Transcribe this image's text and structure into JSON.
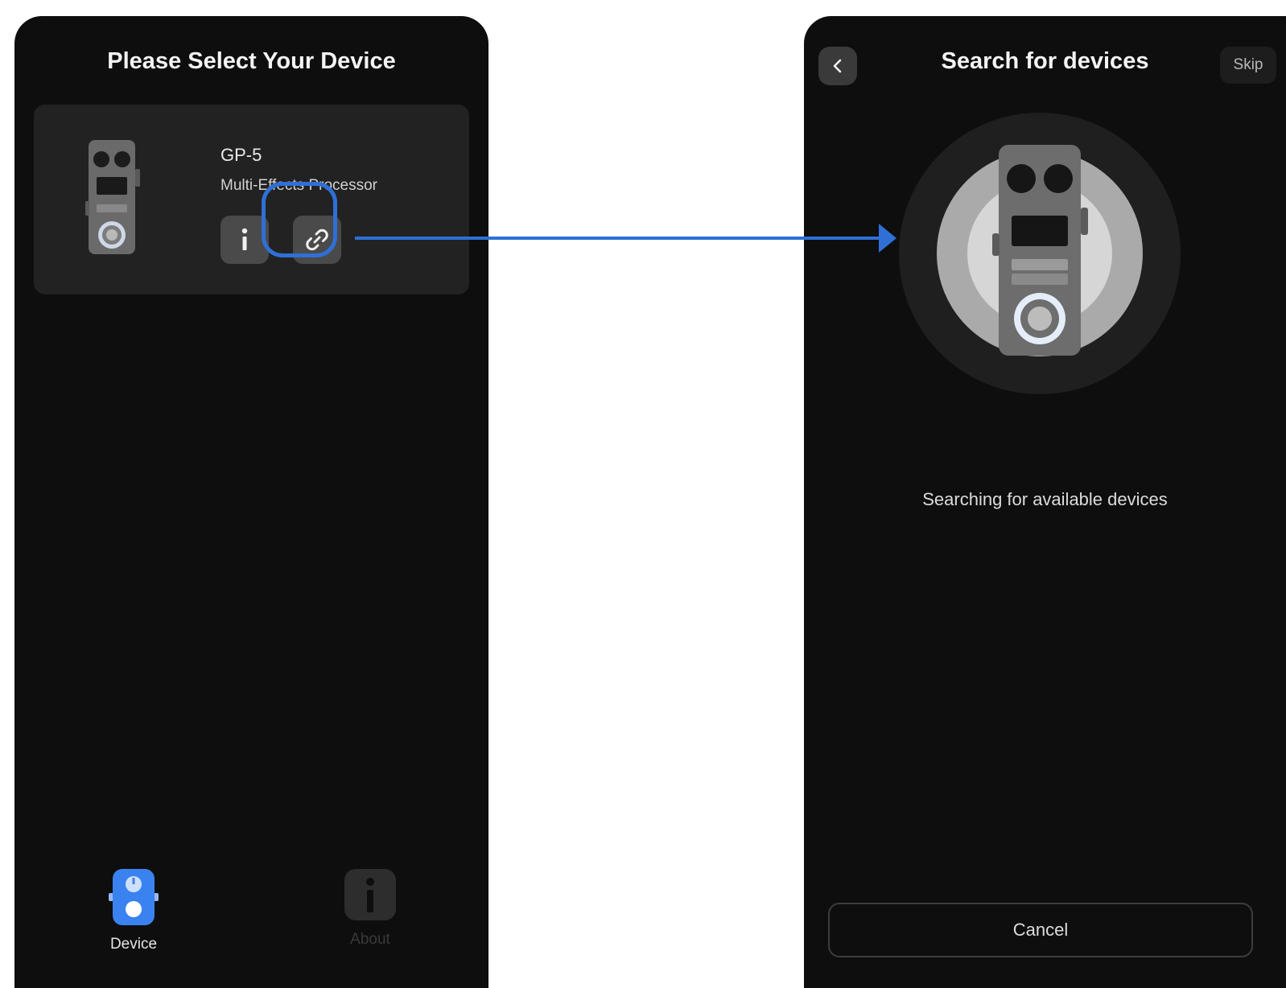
{
  "left_screen": {
    "title": "Please Select Your Device",
    "device": {
      "name": "GP-5",
      "description": "Multi-Effects Processor"
    },
    "tabs": [
      {
        "label": "Device",
        "icon": "pedal-icon",
        "active": true
      },
      {
        "label": "About",
        "icon": "info-icon",
        "active": false
      }
    ]
  },
  "right_screen": {
    "title": "Search for devices",
    "skip_label": "Skip",
    "status": "Searching for available devices",
    "cancel_label": "Cancel"
  },
  "colors": {
    "accent": "#2f6fd6",
    "background": "#0e0e0e",
    "card": "#222222"
  }
}
